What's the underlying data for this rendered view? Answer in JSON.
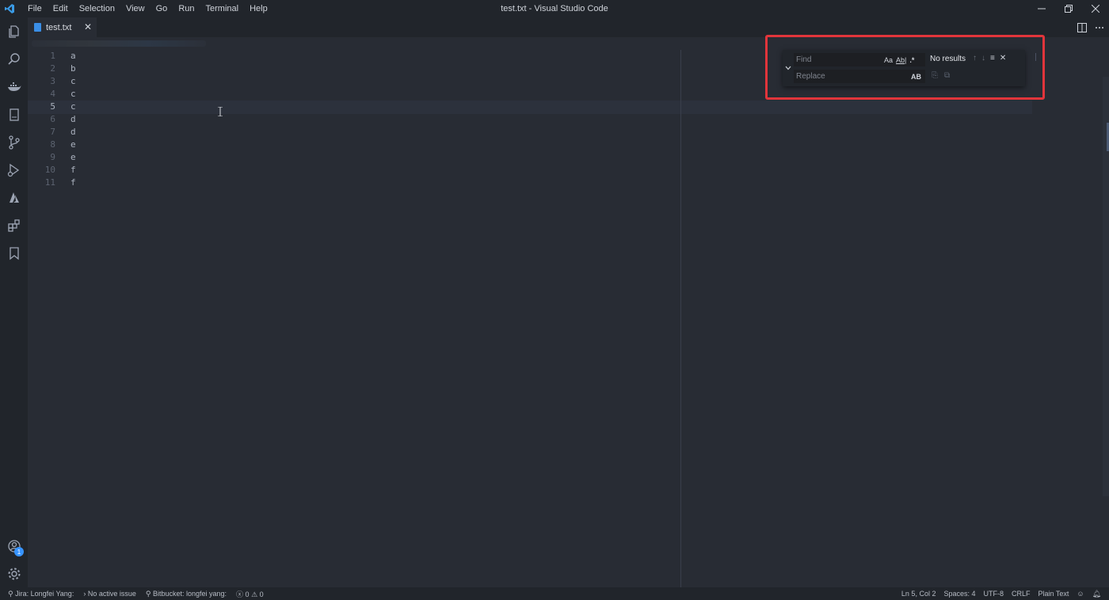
{
  "window": {
    "title": "test.txt - Visual Studio Code"
  },
  "menu": [
    "File",
    "Edit",
    "Selection",
    "View",
    "Go",
    "Run",
    "Terminal",
    "Help"
  ],
  "tab": {
    "label": "test.txt",
    "close": "✕"
  },
  "editor": {
    "lines": [
      {
        "num": "1",
        "text": "a"
      },
      {
        "num": "2",
        "text": "b"
      },
      {
        "num": "3",
        "text": "c"
      },
      {
        "num": "4",
        "text": "c"
      },
      {
        "num": "5",
        "text": "c"
      },
      {
        "num": "6",
        "text": "d"
      },
      {
        "num": "7",
        "text": "d"
      },
      {
        "num": "8",
        "text": "e"
      },
      {
        "num": "9",
        "text": "e"
      },
      {
        "num": "10",
        "text": "f"
      },
      {
        "num": "11",
        "text": "f"
      }
    ],
    "active_line": "5"
  },
  "find": {
    "find_placeholder": "Find",
    "replace_placeholder": "Replace",
    "match_case": "Aa",
    "whole_word": "Ab|",
    "regex": ".*",
    "preserve_case": "AB",
    "result": "No results"
  },
  "activity_badge": "1",
  "status": {
    "jira": "Jira: Longfei Yang:",
    "issue": "No active issue",
    "bitbucket": "Bitbucket: longfei yang:",
    "errors": "0",
    "warnings": "0",
    "position": "Ln 5, Col 2",
    "spaces": "Spaces: 4",
    "encoding": "UTF-8",
    "eol": "CRLF",
    "language": "Plain Text"
  },
  "colors": {
    "accent": "#3794ff",
    "highlight": "#e2353b",
    "background": "#282c34"
  }
}
